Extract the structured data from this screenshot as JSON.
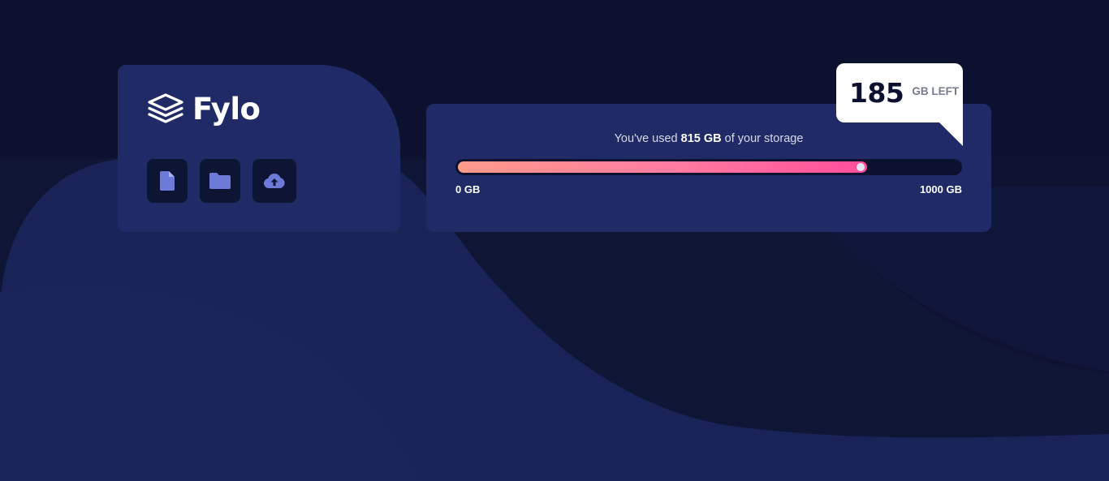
{
  "brand": {
    "name": "Fylo",
    "logo_icon": "layers-stack-icon"
  },
  "actions": [
    {
      "name": "file-button",
      "icon": "document-icon"
    },
    {
      "name": "folder-button",
      "icon": "folder-icon"
    },
    {
      "name": "upload-button",
      "icon": "cloud-upload-icon"
    }
  ],
  "storage": {
    "usage_prefix": "You've used ",
    "used_amount": "815 GB",
    "usage_suffix": " of your storage",
    "used_gb": 815,
    "total_gb": 1000,
    "min_label": "0 GB",
    "max_label": "1000 GB"
  },
  "callout": {
    "remaining": "185",
    "unit_label": "GB LEFT"
  },
  "colors": {
    "page_background": "#0d1130",
    "card_background": "#1f2a67",
    "icon_tile": "#0e1434",
    "icon_accent": "#6d7ad8",
    "gradient_start": "#ff9a8b",
    "gradient_end": "#ff4f9b",
    "text_primary": "#ffffff",
    "callout_background": "#ffffff"
  }
}
